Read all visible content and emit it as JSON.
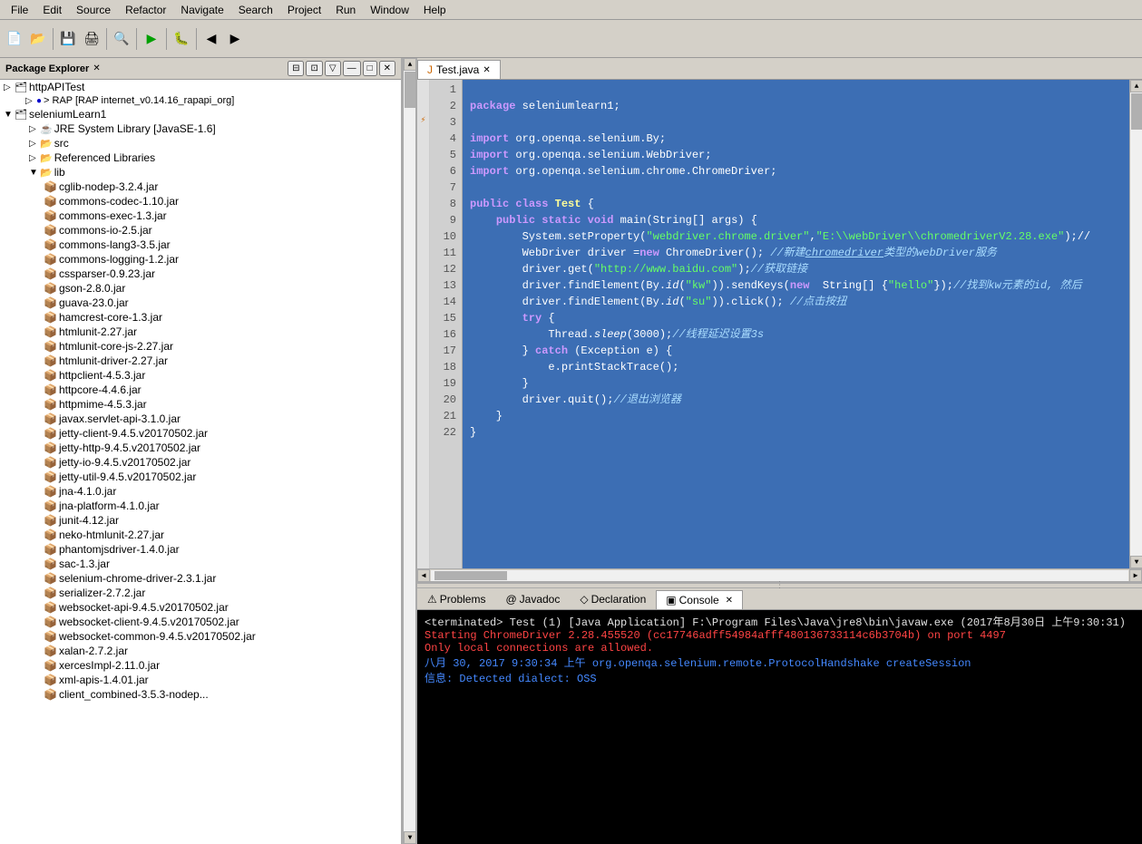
{
  "menubar": {
    "items": [
      "File",
      "Edit",
      "Source",
      "Refactor",
      "Navigate",
      "Search",
      "Project",
      "Run",
      "Window",
      "Help"
    ]
  },
  "explorer": {
    "title": "Package Explorer",
    "header_icons": [
      "⊟",
      "⊡",
      "▽",
      "—",
      "□",
      "✕"
    ],
    "items": [
      {
        "indent": 0,
        "arrow": "▷",
        "icon": "📁",
        "label": "httpAPITest",
        "color": "#000"
      },
      {
        "indent": 12,
        "arrow": "▷",
        "icon": "🔵",
        "label": "> RAP [RAP internet_v0.14.16_rapapi_org]",
        "color": "#000"
      },
      {
        "indent": 0,
        "arrow": "▼",
        "icon": "📁",
        "label": "seleniumLearn1",
        "color": "#000"
      },
      {
        "indent": 12,
        "arrow": "▷",
        "icon": "☕",
        "label": "JRE System Library [JavaSE-1.6]",
        "color": "#000"
      },
      {
        "indent": 12,
        "arrow": "▷",
        "icon": "📂",
        "label": "src",
        "color": "#000"
      },
      {
        "indent": 12,
        "arrow": "▷",
        "icon": "📂",
        "label": "Referenced Libraries",
        "color": "#000"
      },
      {
        "indent": 12,
        "arrow": "▼",
        "icon": "📂",
        "label": "lib",
        "color": "#000"
      },
      {
        "indent": 24,
        "arrow": "",
        "icon": "🟫",
        "label": "cglib-nodep-3.2.4.jar",
        "color": "#000"
      },
      {
        "indent": 24,
        "arrow": "",
        "icon": "🟫",
        "label": "commons-codec-1.10.jar",
        "color": "#000"
      },
      {
        "indent": 24,
        "arrow": "",
        "icon": "🟫",
        "label": "commons-exec-1.3.jar",
        "color": "#000"
      },
      {
        "indent": 24,
        "arrow": "",
        "icon": "🟫",
        "label": "commons-io-2.5.jar",
        "color": "#000"
      },
      {
        "indent": 24,
        "arrow": "",
        "icon": "🟫",
        "label": "commons-lang3-3.5.jar",
        "color": "#000"
      },
      {
        "indent": 24,
        "arrow": "",
        "icon": "🟫",
        "label": "commons-logging-1.2.jar",
        "color": "#000"
      },
      {
        "indent": 24,
        "arrow": "",
        "icon": "🟫",
        "label": "cssparser-0.9.23.jar",
        "color": "#000"
      },
      {
        "indent": 24,
        "arrow": "",
        "icon": "🟫",
        "label": "gson-2.8.0.jar",
        "color": "#000"
      },
      {
        "indent": 24,
        "arrow": "",
        "icon": "🟫",
        "label": "guava-23.0.jar",
        "color": "#000"
      },
      {
        "indent": 24,
        "arrow": "",
        "icon": "🟫",
        "label": "hamcrest-core-1.3.jar",
        "color": "#000"
      },
      {
        "indent": 24,
        "arrow": "",
        "icon": "🟫",
        "label": "htmlunit-2.27.jar",
        "color": "#000"
      },
      {
        "indent": 24,
        "arrow": "",
        "icon": "🟫",
        "label": "htmlunit-core-js-2.27.jar",
        "color": "#000"
      },
      {
        "indent": 24,
        "arrow": "",
        "icon": "🟫",
        "label": "htmlunit-driver-2.27.jar",
        "color": "#000"
      },
      {
        "indent": 24,
        "arrow": "",
        "icon": "🟫",
        "label": "httpclient-4.5.3.jar",
        "color": "#000"
      },
      {
        "indent": 24,
        "arrow": "",
        "icon": "🟫",
        "label": "httpcore-4.4.6.jar",
        "color": "#000"
      },
      {
        "indent": 24,
        "arrow": "",
        "icon": "🟫",
        "label": "httpmime-4.5.3.jar",
        "color": "#000"
      },
      {
        "indent": 24,
        "arrow": "",
        "icon": "🟫",
        "label": "javax.servlet-api-3.1.0.jar",
        "color": "#000"
      },
      {
        "indent": 24,
        "arrow": "",
        "icon": "🟫",
        "label": "jetty-client-9.4.5.v20170502.jar",
        "color": "#000"
      },
      {
        "indent": 24,
        "arrow": "",
        "icon": "🟫",
        "label": "jetty-http-9.4.5.v20170502.jar",
        "color": "#000"
      },
      {
        "indent": 24,
        "arrow": "",
        "icon": "🟫",
        "label": "jetty-io-9.4.5.v20170502.jar",
        "color": "#000"
      },
      {
        "indent": 24,
        "arrow": "",
        "icon": "🟫",
        "label": "jetty-util-9.4.5.v20170502.jar",
        "color": "#000"
      },
      {
        "indent": 24,
        "arrow": "",
        "icon": "🟫",
        "label": "jna-4.1.0.jar",
        "color": "#000"
      },
      {
        "indent": 24,
        "arrow": "",
        "icon": "🟫",
        "label": "jna-platform-4.1.0.jar",
        "color": "#000"
      },
      {
        "indent": 24,
        "arrow": "",
        "icon": "🟫",
        "label": "junit-4.12.jar",
        "color": "#000"
      },
      {
        "indent": 24,
        "arrow": "",
        "icon": "🟫",
        "label": "neko-htmlunit-2.27.jar",
        "color": "#000"
      },
      {
        "indent": 24,
        "arrow": "",
        "icon": "🟫",
        "label": "phantomjsdriver-1.4.0.jar",
        "color": "#000"
      },
      {
        "indent": 24,
        "arrow": "",
        "icon": "🟫",
        "label": "sac-1.3.jar",
        "color": "#000"
      },
      {
        "indent": 24,
        "arrow": "",
        "icon": "🟫",
        "label": "selenium-chrome-driver-2.3.1.jar",
        "color": "#000"
      },
      {
        "indent": 24,
        "arrow": "",
        "icon": "🟫",
        "label": "serializer-2.7.2.jar",
        "color": "#000"
      },
      {
        "indent": 24,
        "arrow": "",
        "icon": "🟫",
        "label": "websocket-api-9.4.5.v20170502.jar",
        "color": "#000"
      },
      {
        "indent": 24,
        "arrow": "",
        "icon": "🟫",
        "label": "websocket-client-9.4.5.v20170502.jar",
        "color": "#000"
      },
      {
        "indent": 24,
        "arrow": "",
        "icon": "🟫",
        "label": "websocket-common-9.4.5.v20170502.jar",
        "color": "#000"
      },
      {
        "indent": 24,
        "arrow": "",
        "icon": "🟫",
        "label": "xalan-2.7.2.jar",
        "color": "#000"
      },
      {
        "indent": 24,
        "arrow": "",
        "icon": "🟫",
        "label": "xercesImpl-2.11.0.jar",
        "color": "#000"
      },
      {
        "indent": 24,
        "arrow": "",
        "icon": "🟫",
        "label": "xml-apis-1.4.01.jar",
        "color": "#000"
      }
    ]
  },
  "editor": {
    "tab_label": "Test.java",
    "lines": [
      {
        "num": 1,
        "code": "package seleniumlearn1;",
        "type": "normal"
      },
      {
        "num": 2,
        "code": "",
        "type": "normal"
      },
      {
        "num": 3,
        "code": "import org.openqa.selenium.By;",
        "type": "import"
      },
      {
        "num": 4,
        "code": "import org.openqa.selenium.WebDriver;",
        "type": "import"
      },
      {
        "num": 5,
        "code": "import org.openqa.selenium.chrome.ChromeDriver;",
        "type": "import"
      },
      {
        "num": 6,
        "code": "",
        "type": "normal"
      },
      {
        "num": 7,
        "code": "public class Test {",
        "type": "class"
      },
      {
        "num": 8,
        "code": "    public static void main(String[] args) {",
        "type": "method"
      },
      {
        "num": 9,
        "code": "        System.setProperty(\"webdriver.chrome.driver\",\"E:\\\\webDriver\\\\chromedriverV2.28.exe\");",
        "type": "code"
      },
      {
        "num": 10,
        "code": "        WebDriver driver =new ChromeDriver(); //新建chromedriver类型的webDriver服务",
        "type": "code"
      },
      {
        "num": 11,
        "code": "        driver.get(\"http://www.baidu.com\");//获取链接",
        "type": "code"
      },
      {
        "num": 12,
        "code": "        driver.findElement(By.id(\"kw\")).sendKeys(new  String[] {\"hello\"});//找到kw元素的id, 然后",
        "type": "code"
      },
      {
        "num": 13,
        "code": "        driver.findElement(By.id(\"su\")).click(); //点击按扭",
        "type": "code"
      },
      {
        "num": 14,
        "code": "        try {",
        "type": "code"
      },
      {
        "num": 15,
        "code": "            Thread.sleep(3000);//线程延迟设置3s",
        "type": "code"
      },
      {
        "num": 16,
        "code": "        } catch (Exception e) {",
        "type": "code"
      },
      {
        "num": 17,
        "code": "            e.printStackTrace();",
        "type": "code"
      },
      {
        "num": 18,
        "code": "        }",
        "type": "code"
      },
      {
        "num": 19,
        "code": "        driver.quit();//退出浏览器",
        "type": "code"
      },
      {
        "num": 20,
        "code": "    }",
        "type": "code"
      },
      {
        "num": 21,
        "code": "}",
        "type": "code"
      },
      {
        "num": 22,
        "code": "",
        "type": "normal"
      }
    ]
  },
  "bottom_panel": {
    "tabs": [
      {
        "label": "⚠ Problems",
        "active": false
      },
      {
        "label": "@ Javadoc",
        "active": false
      },
      {
        "label": "◇ Declaration",
        "active": false
      },
      {
        "label": "▣ Console",
        "active": true,
        "close": "✕"
      }
    ],
    "console": {
      "terminated": "<terminated> Test (1) [Java Application] F:\\Program Files\\Java\\jre8\\bin\\javaw.exe (2017年8月30日 上午9:30:31)",
      "line1": "Starting ChromeDriver 2.28.455520 (cc17746adff54984afff480136733114c6b3704b) on port 4497",
      "line2": "Only local connections are allowed.",
      "line3": "八月 30, 2017 9:30:34 上午 org.openqa.selenium.remote.ProtocolHandshake createSession",
      "line4": "信息: Detected dialect: OSS"
    }
  }
}
